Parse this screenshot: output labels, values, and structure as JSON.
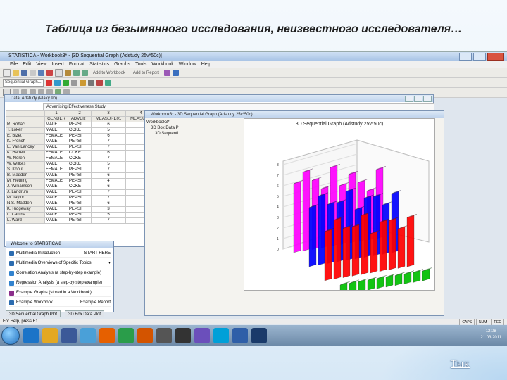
{
  "slide": {
    "title": "Таблица из безымянного исследования, неизвестного исследователя…",
    "next_link": "Тык"
  },
  "app": {
    "title": "STATISTICA - Workbook3* - [3D Sequential Graph (Adstudy 25v*50c)]",
    "menu": [
      "File",
      "Edit",
      "View",
      "Insert",
      "Format",
      "Statistics",
      "Graphs",
      "Tools",
      "Workbook",
      "Window",
      "Help"
    ],
    "toolbar": {
      "add_to_workbook": "Add to Workbook",
      "add_to_report": "Add to Report",
      "graph_combo": "Sequential Graph..."
    }
  },
  "spreadsheet": {
    "title": "Data: Adstudy (Plaky 9h)",
    "banner": "Advertising Effectiveness Study",
    "col_numbers": [
      "1",
      "2",
      "3",
      "4"
    ],
    "col_headers": [
      "GENDER",
      "ADVERT",
      "MEASURE01",
      "MEASURE"
    ],
    "rows": [
      {
        "name": "R. Rohac",
        "gender": "MALE",
        "advert": "PEPSI",
        "m1": "6"
      },
      {
        "name": "T. Loker",
        "gender": "MALE",
        "advert": "COKE",
        "m1": "5"
      },
      {
        "name": "E. Bizet",
        "gender": "FEMALE",
        "advert": "PEPSI",
        "m1": "6"
      },
      {
        "name": "K. French",
        "gender": "MALE",
        "advert": "PEPSI",
        "m1": "7"
      },
      {
        "name": "E. Van Lancey",
        "gender": "MALE",
        "advert": "PEPSI",
        "m1": "7"
      },
      {
        "name": "K. Harrell",
        "gender": "FEMALE",
        "advert": "COKE",
        "m1": "6"
      },
      {
        "name": "W. Noren",
        "gender": "FEMALE",
        "advert": "COKE",
        "m1": "7"
      },
      {
        "name": "W. Wilkes",
        "gender": "MALE",
        "advert": "COKE",
        "m1": "5"
      },
      {
        "name": "S. Kohut",
        "gender": "FEMALE",
        "advert": "PEPSI",
        "m1": "7"
      },
      {
        "name": "B. Madden",
        "gender": "MALE",
        "advert": "PEPSI",
        "m1": "6"
      },
      {
        "name": "M. Fiedling",
        "gender": "FEMALE",
        "advert": "PEPSI",
        "m1": "4"
      },
      {
        "name": "J. Williamson",
        "gender": "MALE",
        "advert": "COKE",
        "m1": "6"
      },
      {
        "name": "J. Landrum",
        "gender": "MALE",
        "advert": "PEPSI",
        "m1": "7"
      },
      {
        "name": "M. Taylor",
        "gender": "MALE",
        "advert": "PEPSI",
        "m1": "7"
      },
      {
        "name": "N.S. Madden",
        "gender": "MALE",
        "advert": "PEPSI",
        "m1": "6"
      },
      {
        "name": "K. Ridgeway",
        "gender": "MALE",
        "advert": "PEPSI",
        "m1": "3"
      },
      {
        "name": "L. Cantha",
        "gender": "MALE",
        "advert": "PEPSI",
        "m1": "5"
      },
      {
        "name": "L. Ward",
        "gender": "MALE",
        "advert": "PEPSI",
        "m1": "7"
      }
    ]
  },
  "graph_window": {
    "title": "Workbook3* - 3D Sequential Graph (Adstudy 25v*50c)",
    "tree": [
      "Workbook3*",
      "3D Box Data P",
      "3D Sequenti"
    ],
    "graph_title": "3D Sequential Graph (Adstudy 25v*50c)",
    "z_ticks": [
      "8",
      "7",
      "6",
      "5",
      "4",
      "3",
      "2",
      "1",
      "0"
    ]
  },
  "chart_data": {
    "type": "bar",
    "title": "3D Sequential Graph (Adstudy 25v*50c)",
    "ylim": [
      0,
      8
    ],
    "series": [
      {
        "name": "",
        "color": "#ff00ff",
        "values": [
          7,
          8,
          7,
          6,
          8,
          6,
          7,
          6,
          5,
          7
        ]
      },
      {
        "name": "",
        "color": "#0000ff",
        "values": [
          6,
          7,
          6,
          6,
          7,
          5,
          6,
          6,
          5,
          6
        ]
      },
      {
        "name": "",
        "color": "#ff0000",
        "values": [
          5,
          6,
          5,
          5,
          6,
          4,
          5,
          5,
          4,
          5
        ]
      },
      {
        "name": "",
        "color": "#00c000",
        "values": [
          1,
          1,
          1,
          1,
          1,
          1,
          1,
          1,
          1,
          1
        ]
      }
    ]
  },
  "welcome": {
    "title": "Welcome to STATISTICA 8",
    "items": [
      {
        "label": "Multimedia Introduction",
        "action": "START HERE"
      },
      {
        "label": "Multimedia Overviews of Specific Topics",
        "action": "▾"
      },
      {
        "label": "Correlation Analysis (a step-by-step example)",
        "action": ""
      },
      {
        "label": "Regression Analysis (a step-by-step example)",
        "action": ""
      },
      {
        "label": "Example Graphs (stored in a Workbook)",
        "action": ""
      },
      {
        "label": "Example Workbook",
        "action": "Example Report"
      }
    ]
  },
  "tabs": [
    "3D Sequential Graph Plot",
    "3D Box Data Plot"
  ],
  "status": {
    "left": "For Help, press F1",
    "right": [
      "CAPS",
      "NUM",
      "REC"
    ]
  },
  "taskbar": {
    "icons": [
      "ie-icon",
      "explorer-icon",
      "media-icon",
      "mail-icon",
      "firefox-icon",
      "chrome-icon",
      "at-icon",
      "film-icon",
      "word-icon",
      "aftereffects-icon",
      "skype-icon",
      "photoshop-icon",
      "statistica-icon"
    ],
    "time": "12:08",
    "date": "21.03.2011"
  }
}
